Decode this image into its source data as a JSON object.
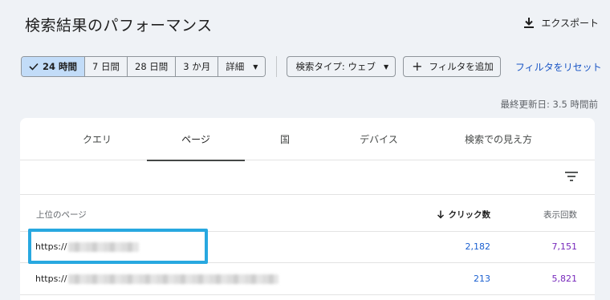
{
  "header": {
    "title": "検索結果のパフォーマンス",
    "export_label": "エクスポート"
  },
  "toolbar": {
    "date_ranges": [
      {
        "label": "24 時間",
        "selected": true
      },
      {
        "label": "7 日間",
        "selected": false
      },
      {
        "label": "28 日間",
        "selected": false
      },
      {
        "label": "3 か月",
        "selected": false
      }
    ],
    "detail_label": "詳細",
    "search_type_label": "検索タイプ: ウェブ",
    "add_filter_label": "フィルタを追加",
    "reset_filters_label": "フィルタをリセット"
  },
  "last_updated": "最終更新日: 3.5 時間前",
  "tabs": [
    {
      "label": "クエリ",
      "active": false
    },
    {
      "label": "ページ",
      "active": true
    },
    {
      "label": "国",
      "active": false
    },
    {
      "label": "デバイス",
      "active": false
    },
    {
      "label": "検索での見え方",
      "active": false
    }
  ],
  "table": {
    "columns": {
      "page": "上位のページ",
      "clicks": "クリック数",
      "impressions": "表示回数"
    },
    "rows": [
      {
        "url_prefix": "https://",
        "clicks": "2,182",
        "impressions": "7,151"
      },
      {
        "url_prefix": "https://",
        "clicks": "213",
        "impressions": "5,821"
      }
    ]
  },
  "colors": {
    "accent_blue": "#1a56c5",
    "clicks_blue": "#1a5fd0",
    "impressions_purple": "#7627bb",
    "highlight_border": "#28a8e0",
    "selected_segment": "#c2dcf8"
  },
  "icons": {
    "export": "download-icon",
    "check": "check-icon",
    "caret": "caret-down-icon",
    "plus": "plus-icon",
    "filter": "filter-list-icon",
    "sort": "arrow-down-icon"
  }
}
